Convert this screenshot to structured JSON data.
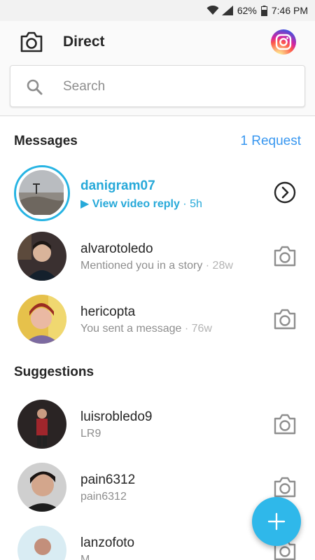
{
  "status_bar": {
    "battery": "62%",
    "time": "7:46 PM"
  },
  "header": {
    "title": "Direct"
  },
  "search": {
    "placeholder": "Search"
  },
  "messages": {
    "title": "Messages",
    "request_label": "1 Request",
    "items": [
      {
        "username": "danigram07",
        "subtitle": "▶ View video reply",
        "time": " · 5h",
        "highlighted": true
      },
      {
        "username": "alvarotoledo",
        "subtitle": "Mentioned you in a story",
        "time": " · 28w"
      },
      {
        "username": "hericopta",
        "subtitle": "You sent a message",
        "time": " · 76w"
      }
    ]
  },
  "suggestions": {
    "title": "Suggestions",
    "items": [
      {
        "username": "luisrobledo9",
        "subtitle": "LR9"
      },
      {
        "username": "pain6312",
        "subtitle": "pain6312"
      },
      {
        "username": "lanzofoto",
        "subtitle": "M"
      }
    ]
  },
  "fab": {
    "icon": "plus-icon"
  },
  "colors": {
    "accent": "#27a9d9",
    "request": "#3897f0",
    "fab": "#2fb8ea"
  }
}
